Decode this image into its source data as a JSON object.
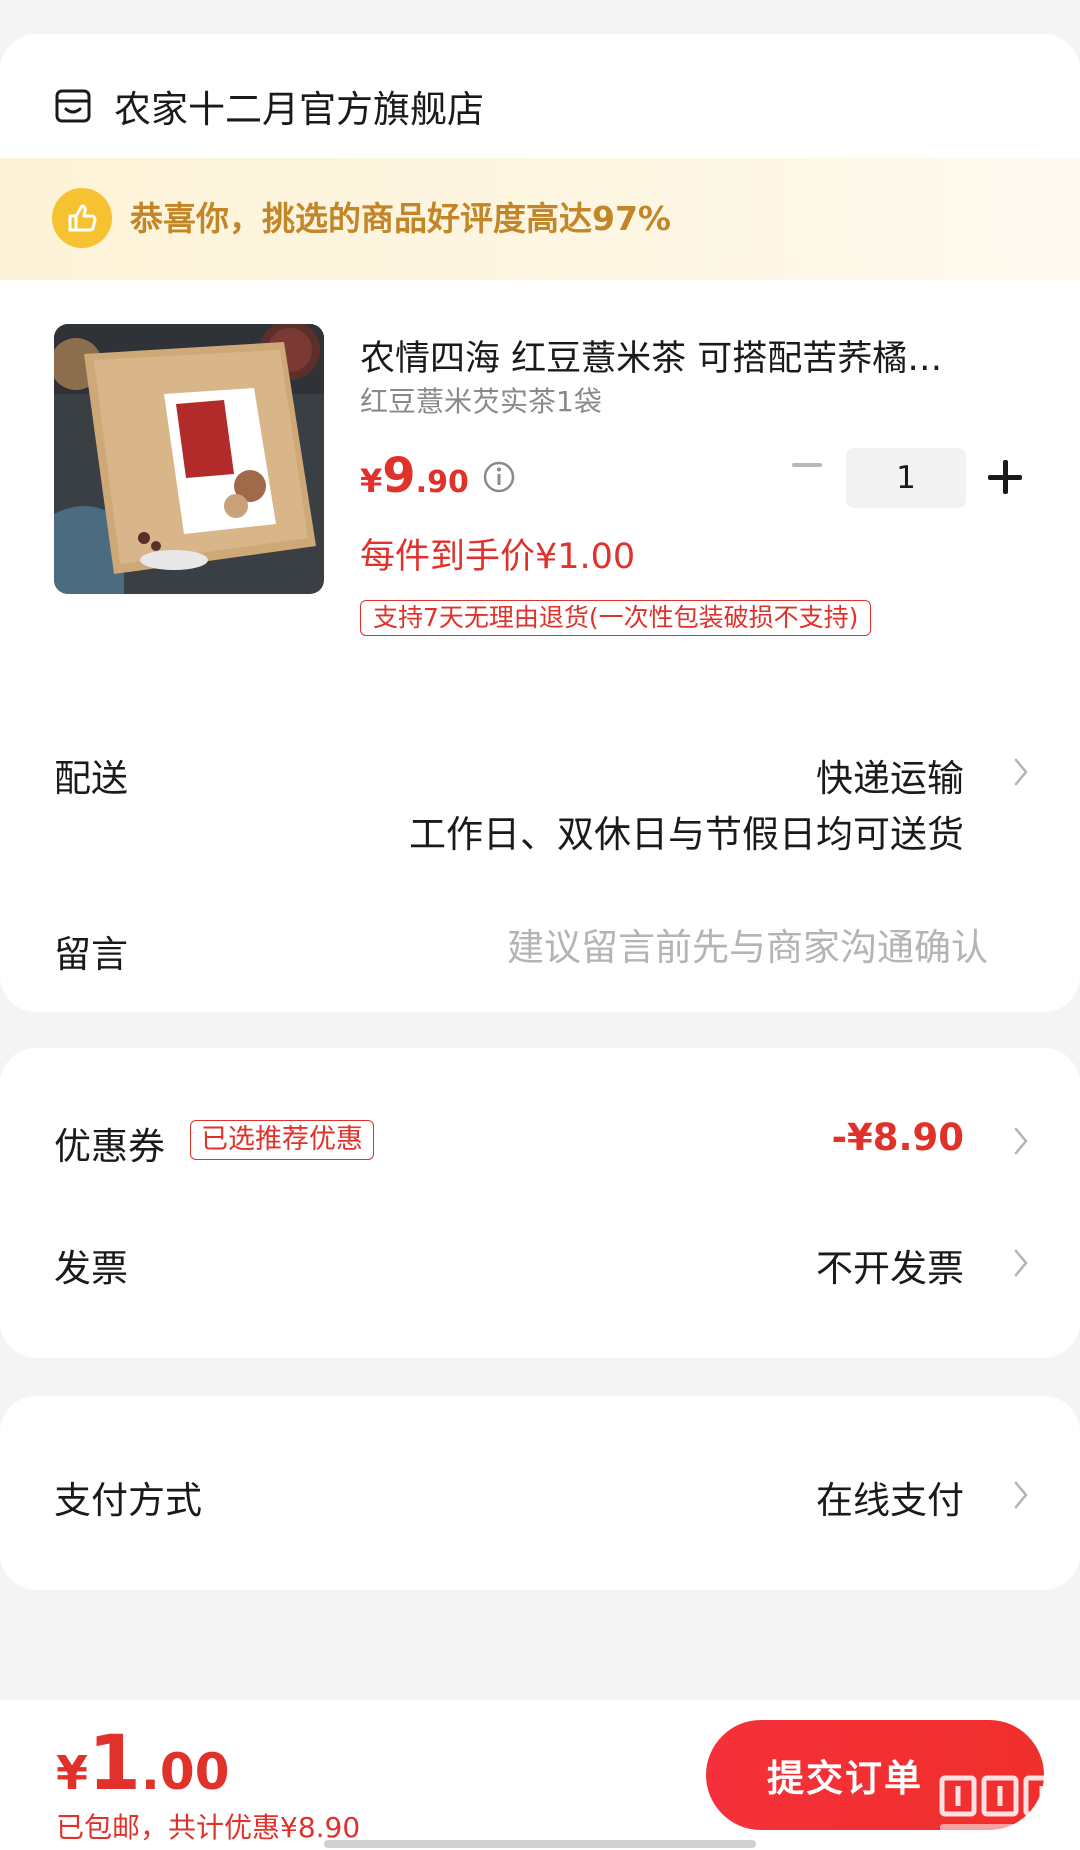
{
  "store": {
    "name": "农家十二月官方旗舰店",
    "icon": "store-icon"
  },
  "banner": {
    "text": "恭喜你，挑选的商品好评度高达97%",
    "icon": "thumbs-up-icon"
  },
  "product": {
    "title": "农情四海 红豆薏米茶 可搭配苦荞橘…",
    "spec": "红豆薏米芡实茶1袋",
    "price_yen": "¥",
    "price_int": "9",
    "price_dec": ".90",
    "per_piece": "每件到手价¥1.00",
    "return_policy": "支持7天无理由退货(一次性包装破损不支持)",
    "quantity": "1"
  },
  "delivery": {
    "label": "配送",
    "value": "快递运输",
    "sub": "工作日、双休日与节假日均可送货"
  },
  "message": {
    "label": "留言",
    "placeholder": "建议留言前先与商家沟通确认"
  },
  "coupon": {
    "label": "优惠券",
    "tag": "已选推荐优惠",
    "value": "-¥8.90"
  },
  "invoice": {
    "label": "发票",
    "value": "不开发票"
  },
  "payment": {
    "label": "支付方式",
    "value": "在线支付"
  },
  "footer": {
    "total_yen": "¥",
    "total_int": "1",
    "total_dec": ".00",
    "summary": "已包邮，共计优惠¥8.90",
    "submit_label": "提交订单"
  },
  "colors": {
    "accent": "#e0322b",
    "banner_text": "#c28628",
    "banner_icon": "#f7c232"
  }
}
